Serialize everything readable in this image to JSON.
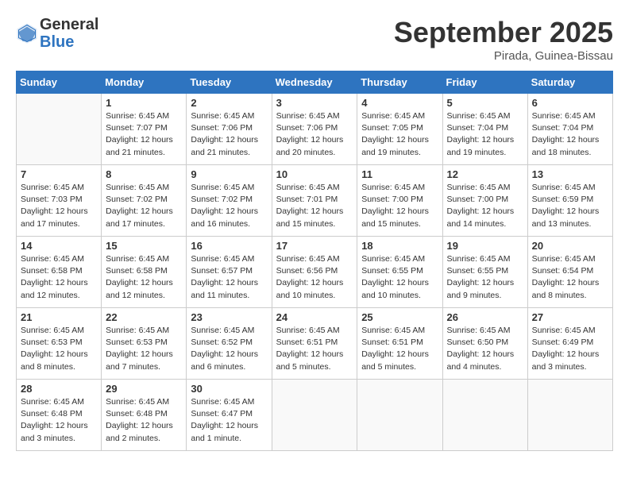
{
  "logo": {
    "general": "General",
    "blue": "Blue"
  },
  "title": "September 2025",
  "location": "Pirada, Guinea-Bissau",
  "weekdays": [
    "Sunday",
    "Monday",
    "Tuesday",
    "Wednesday",
    "Thursday",
    "Friday",
    "Saturday"
  ],
  "weeks": [
    [
      {
        "day": "",
        "info": ""
      },
      {
        "day": "1",
        "info": "Sunrise: 6:45 AM\nSunset: 7:07 PM\nDaylight: 12 hours\nand 21 minutes."
      },
      {
        "day": "2",
        "info": "Sunrise: 6:45 AM\nSunset: 7:06 PM\nDaylight: 12 hours\nand 21 minutes."
      },
      {
        "day": "3",
        "info": "Sunrise: 6:45 AM\nSunset: 7:06 PM\nDaylight: 12 hours\nand 20 minutes."
      },
      {
        "day": "4",
        "info": "Sunrise: 6:45 AM\nSunset: 7:05 PM\nDaylight: 12 hours\nand 19 minutes."
      },
      {
        "day": "5",
        "info": "Sunrise: 6:45 AM\nSunset: 7:04 PM\nDaylight: 12 hours\nand 19 minutes."
      },
      {
        "day": "6",
        "info": "Sunrise: 6:45 AM\nSunset: 7:04 PM\nDaylight: 12 hours\nand 18 minutes."
      }
    ],
    [
      {
        "day": "7",
        "info": "Sunrise: 6:45 AM\nSunset: 7:03 PM\nDaylight: 12 hours\nand 17 minutes."
      },
      {
        "day": "8",
        "info": "Sunrise: 6:45 AM\nSunset: 7:02 PM\nDaylight: 12 hours\nand 17 minutes."
      },
      {
        "day": "9",
        "info": "Sunrise: 6:45 AM\nSunset: 7:02 PM\nDaylight: 12 hours\nand 16 minutes."
      },
      {
        "day": "10",
        "info": "Sunrise: 6:45 AM\nSunset: 7:01 PM\nDaylight: 12 hours\nand 15 minutes."
      },
      {
        "day": "11",
        "info": "Sunrise: 6:45 AM\nSunset: 7:00 PM\nDaylight: 12 hours\nand 15 minutes."
      },
      {
        "day": "12",
        "info": "Sunrise: 6:45 AM\nSunset: 7:00 PM\nDaylight: 12 hours\nand 14 minutes."
      },
      {
        "day": "13",
        "info": "Sunrise: 6:45 AM\nSunset: 6:59 PM\nDaylight: 12 hours\nand 13 minutes."
      }
    ],
    [
      {
        "day": "14",
        "info": "Sunrise: 6:45 AM\nSunset: 6:58 PM\nDaylight: 12 hours\nand 12 minutes."
      },
      {
        "day": "15",
        "info": "Sunrise: 6:45 AM\nSunset: 6:58 PM\nDaylight: 12 hours\nand 12 minutes."
      },
      {
        "day": "16",
        "info": "Sunrise: 6:45 AM\nSunset: 6:57 PM\nDaylight: 12 hours\nand 11 minutes."
      },
      {
        "day": "17",
        "info": "Sunrise: 6:45 AM\nSunset: 6:56 PM\nDaylight: 12 hours\nand 10 minutes."
      },
      {
        "day": "18",
        "info": "Sunrise: 6:45 AM\nSunset: 6:55 PM\nDaylight: 12 hours\nand 10 minutes."
      },
      {
        "day": "19",
        "info": "Sunrise: 6:45 AM\nSunset: 6:55 PM\nDaylight: 12 hours\nand 9 minutes."
      },
      {
        "day": "20",
        "info": "Sunrise: 6:45 AM\nSunset: 6:54 PM\nDaylight: 12 hours\nand 8 minutes."
      }
    ],
    [
      {
        "day": "21",
        "info": "Sunrise: 6:45 AM\nSunset: 6:53 PM\nDaylight: 12 hours\nand 8 minutes."
      },
      {
        "day": "22",
        "info": "Sunrise: 6:45 AM\nSunset: 6:53 PM\nDaylight: 12 hours\nand 7 minutes."
      },
      {
        "day": "23",
        "info": "Sunrise: 6:45 AM\nSunset: 6:52 PM\nDaylight: 12 hours\nand 6 minutes."
      },
      {
        "day": "24",
        "info": "Sunrise: 6:45 AM\nSunset: 6:51 PM\nDaylight: 12 hours\nand 5 minutes."
      },
      {
        "day": "25",
        "info": "Sunrise: 6:45 AM\nSunset: 6:51 PM\nDaylight: 12 hours\nand 5 minutes."
      },
      {
        "day": "26",
        "info": "Sunrise: 6:45 AM\nSunset: 6:50 PM\nDaylight: 12 hours\nand 4 minutes."
      },
      {
        "day": "27",
        "info": "Sunrise: 6:45 AM\nSunset: 6:49 PM\nDaylight: 12 hours\nand 3 minutes."
      }
    ],
    [
      {
        "day": "28",
        "info": "Sunrise: 6:45 AM\nSunset: 6:48 PM\nDaylight: 12 hours\nand 3 minutes."
      },
      {
        "day": "29",
        "info": "Sunrise: 6:45 AM\nSunset: 6:48 PM\nDaylight: 12 hours\nand 2 minutes."
      },
      {
        "day": "30",
        "info": "Sunrise: 6:45 AM\nSunset: 6:47 PM\nDaylight: 12 hours\nand 1 minute."
      },
      {
        "day": "",
        "info": ""
      },
      {
        "day": "",
        "info": ""
      },
      {
        "day": "",
        "info": ""
      },
      {
        "day": "",
        "info": ""
      }
    ]
  ]
}
